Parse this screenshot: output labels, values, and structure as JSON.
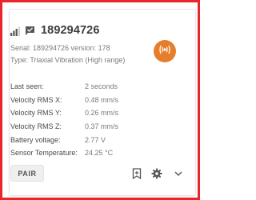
{
  "device": {
    "id": "189294726",
    "serial_line": "Serial: 189294726 version: 178",
    "type_line": "Type: Triaxial Vibration (High range)"
  },
  "properties": [
    {
      "label": "Last seen:",
      "value": "2 seconds"
    },
    {
      "label": "Velocity RMS X:",
      "value": "0.48 mm/s"
    },
    {
      "label": "Velocity RMS Y:",
      "value": "0.26 mm/s"
    },
    {
      "label": "Velocity RMS Z:",
      "value": "0.37 mm/s"
    },
    {
      "label": "Battery voltage:",
      "value": "2.77 V"
    },
    {
      "label": "Sensor Temperature:",
      "value": "24.25 °C"
    }
  ],
  "actions": {
    "pair_label": "PAIR"
  },
  "icons": {
    "signal": "signal-strength-icon",
    "message": "message-icon",
    "vibration": "vibration-sensor-icon",
    "bookmark": "bookmark-add-icon",
    "settings": "gear-icon",
    "expand": "chevron-down-icon"
  },
  "colors": {
    "frame_border": "#e8262b",
    "badge": "#e77e2c"
  }
}
